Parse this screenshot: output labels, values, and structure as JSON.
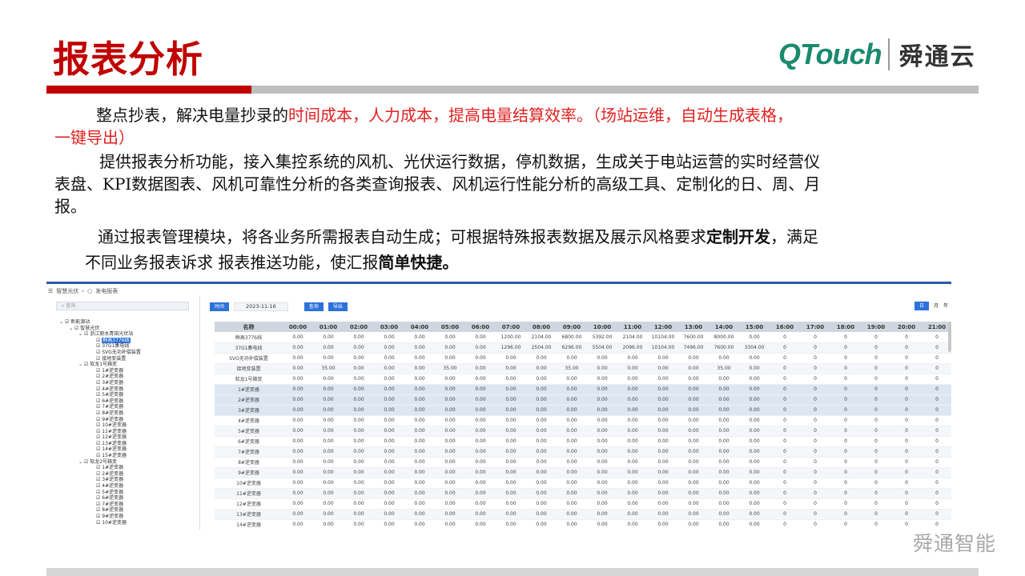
{
  "slide": {
    "title": "报表分析",
    "brand_latin": "QTouch",
    "brand_cn": "舜通云",
    "watermark": "舜通智能"
  },
  "text": {
    "p1_indent_a": "整点抄表，解决电量抄录的",
    "p1_red_a": "时间成本，人力成本，提高电量结算效率。（场站运维，自动生成表格，",
    "p1_red_b": "一键导出）",
    "p2_line1": "提供报表分析功能，接入集控系统的风机、光伏运行数据，停机数据，生成关于电站运营的实时经营仪",
    "p2_line2": "表盘、KPI数据图表、风机可靠性分析的各类查询报表、风机运行性能分析的高级工具、定制化的日、周、月",
    "p2_line3": "报。",
    "p3_line1_a": "通过报表管理模块，将各业务所需报表自动生成；可根据特殊报表数据及展示风格要求",
    "p3_line1_b": "定制开发",
    "p3_line1_c": "，满足",
    "p3_line2_a": "不同业务报表诉求 报表推送功能，使汇报",
    "p3_line2_b": "简单快捷。"
  },
  "app": {
    "breadcrumb": [
      "智慧光伏",
      "发电报表"
    ],
    "search_placeholder": "查询",
    "tree": [
      {
        "label": "新能源站",
        "level": 0,
        "arrow": true
      },
      {
        "label": "智慧光伏",
        "level": 1,
        "arrow": true
      },
      {
        "label": "浙江丽水青田光伏站",
        "level": 2,
        "arrow": true
      },
      {
        "label": "鲜高3776线",
        "level": 3,
        "selected": true
      },
      {
        "label": "37G1集电线",
        "level": 3
      },
      {
        "label": "SVG无功补偿装置",
        "level": 3
      },
      {
        "label": "接地变装置",
        "level": 3
      },
      {
        "label": "软龙1号箱变",
        "level": 2,
        "arrow": true
      },
      {
        "label": "1#逆变器",
        "level": 3
      },
      {
        "label": "2#逆变器",
        "level": 3
      },
      {
        "label": "3#逆变器",
        "level": 3
      },
      {
        "label": "4#逆变器",
        "level": 3
      },
      {
        "label": "5#逆变器",
        "level": 3
      },
      {
        "label": "6#逆变器",
        "level": 3
      },
      {
        "label": "7#逆变器",
        "level": 3
      },
      {
        "label": "8#逆变器",
        "level": 3
      },
      {
        "label": "9#逆变器",
        "level": 3
      },
      {
        "label": "10#逆变器",
        "level": 3
      },
      {
        "label": "11#逆变器",
        "level": 3
      },
      {
        "label": "12#逆变器",
        "level": 3
      },
      {
        "label": "13#逆变器",
        "level": 3
      },
      {
        "label": "14#逆变器",
        "level": 3
      },
      {
        "label": "15#逆变器",
        "level": 3
      },
      {
        "label": "软龙2号箱变",
        "level": 2,
        "arrow": true
      },
      {
        "label": "1#逆变器",
        "level": 3
      },
      {
        "label": "2#逆变器",
        "level": 3
      },
      {
        "label": "3#逆变器",
        "level": 3
      },
      {
        "label": "4#逆变器",
        "level": 3
      },
      {
        "label": "5#逆变器",
        "level": 3
      },
      {
        "label": "6#逆变器",
        "level": 3
      },
      {
        "label": "7#逆变器",
        "level": 3
      },
      {
        "label": "8#逆变器",
        "level": 3
      },
      {
        "label": "9#逆变器",
        "level": 3
      },
      {
        "label": "10#逆变器",
        "level": 3
      }
    ],
    "toolbar": {
      "time_label": "时间",
      "date_value": "2023-11-16",
      "query_label": "查询",
      "export_label": "导出",
      "period_day": "日",
      "period_month": "月",
      "period_year": "年"
    },
    "table": {
      "name_header": "名称",
      "hours": [
        "00:00",
        "01:00",
        "02:00",
        "03:00",
        "04:00",
        "05:00",
        "06:00",
        "07:00",
        "08:00",
        "09:00",
        "10:00",
        "11:00",
        "12:00",
        "13:00",
        "14:00",
        "15:00",
        "16:00",
        "17:00",
        "18:00",
        "19:00",
        "20:00",
        "21:00"
      ],
      "rows": [
        {
          "name": "鲜高3776线",
          "values": [
            "0.00",
            "0.00",
            "0.00",
            "0.00",
            "0.00",
            "0.00",
            "0.00",
            "1200.00",
            "2104.00",
            "6800.00",
            "5392.00",
            "2104.00",
            "10104.00",
            "7600.00",
            "8000.00",
            "0.00",
            "0",
            "0",
            "0",
            "0",
            "0",
            "0"
          ]
        },
        {
          "name": "37G1集电线",
          "values": [
            "0.00",
            "0.00",
            "0.00",
            "0.00",
            "0.00",
            "0.00",
            "0.00",
            "1296.00",
            "2504.00",
            "6296.00",
            "5504.00",
            "2096.00",
            "10104.00",
            "7496.00",
            "7600.00",
            "3304.00",
            "0",
            "0",
            "0",
            "0",
            "0",
            "0"
          ]
        },
        {
          "name": "SVG无功补偿装置",
          "values": [
            "0.00",
            "0.00",
            "0.00",
            "0.00",
            "0.00",
            "0.00",
            "0.00",
            "0.00",
            "0.00",
            "0.00",
            "0.00",
            "0.00",
            "0.00",
            "0.00",
            "0.00",
            "0.00",
            "0",
            "0",
            "0",
            "0",
            "0",
            "0"
          ]
        },
        {
          "name": "接地变装置",
          "values": [
            "0.00",
            "35.00",
            "0.00",
            "0.00",
            "0.00",
            "35.00",
            "0.00",
            "0.00",
            "0.00",
            "35.00",
            "0.00",
            "0.00",
            "0.00",
            "0.00",
            "35.00",
            "0.00",
            "0",
            "0",
            "0",
            "0",
            "0",
            "0"
          ]
        },
        {
          "name": "软龙1号箱变",
          "values": [
            "0.00",
            "0.00",
            "0.00",
            "0.00",
            "0.00",
            "0.00",
            "0.00",
            "0.00",
            "0.00",
            "0.00",
            "0.00",
            "0.00",
            "0.00",
            "0.00",
            "0.00",
            "0.00",
            "0",
            "0",
            "0",
            "0",
            "0",
            "0"
          ]
        },
        {
          "name": "1#逆变器",
          "values": [
            "0.00",
            "0.00",
            "0.00",
            "0.00",
            "0.00",
            "0.00",
            "0.00",
            "0.00",
            "0.00",
            "0.00",
            "0.00",
            "0.00",
            "0.00",
            "0.00",
            "0.00",
            "0.00",
            "0",
            "0",
            "0",
            "0",
            "0",
            "0"
          ]
        },
        {
          "name": "2#逆变器",
          "values": [
            "0.00",
            "0.00",
            "0.00",
            "0.00",
            "0.00",
            "0.00",
            "0.00",
            "0.00",
            "0.00",
            "0.00",
            "0.00",
            "0.00",
            "0.00",
            "0.00",
            "0.00",
            "0.00",
            "0",
            "0",
            "0",
            "0",
            "0",
            "0"
          ]
        },
        {
          "name": "3#逆变器",
          "values": [
            "0.00",
            "0.00",
            "0.00",
            "0.00",
            "0.00",
            "0.00",
            "0.00",
            "0.00",
            "0.00",
            "0.00",
            "0.00",
            "0.00",
            "0.00",
            "0.00",
            "0.00",
            "0.00",
            "0",
            "0",
            "0",
            "0",
            "0",
            "0"
          ]
        },
        {
          "name": "4#逆变器",
          "values": [
            "0.00",
            "0.00",
            "0.00",
            "0.00",
            "0.00",
            "0.00",
            "0.00",
            "0.00",
            "0.00",
            "0.00",
            "0.00",
            "0.00",
            "0.00",
            "0.00",
            "0.00",
            "0.00",
            "0",
            "0",
            "0",
            "0",
            "0",
            "0"
          ]
        },
        {
          "name": "5#逆变器",
          "values": [
            "0.00",
            "0.00",
            "0.00",
            "0.00",
            "0.00",
            "0.00",
            "0.00",
            "0.00",
            "0.00",
            "0.00",
            "0.00",
            "0.00",
            "0.00",
            "0.00",
            "0.00",
            "0.00",
            "0",
            "0",
            "0",
            "0",
            "0",
            "0"
          ]
        },
        {
          "name": "6#逆变器",
          "values": [
            "0.00",
            "0.00",
            "0.00",
            "0.00",
            "0.00",
            "0.00",
            "0.00",
            "0.00",
            "0.00",
            "0.00",
            "0.00",
            "0.00",
            "0.00",
            "0.00",
            "0.00",
            "0.00",
            "0",
            "0",
            "0",
            "0",
            "0",
            "0"
          ]
        },
        {
          "name": "7#逆变器",
          "values": [
            "0.00",
            "0.00",
            "0.00",
            "0.00",
            "0.00",
            "0.00",
            "0.00",
            "0.00",
            "0.00",
            "0.00",
            "0.00",
            "0.00",
            "0.00",
            "0.00",
            "0.00",
            "0.00",
            "0",
            "0",
            "0",
            "0",
            "0",
            "0"
          ]
        },
        {
          "name": "8#逆变器",
          "values": [
            "0.00",
            "0.00",
            "0.00",
            "0.00",
            "0.00",
            "0.00",
            "0.00",
            "0.00",
            "0.00",
            "0.00",
            "0.00",
            "0.00",
            "0.00",
            "0.00",
            "0.00",
            "0.00",
            "0",
            "0",
            "0",
            "0",
            "0",
            "0"
          ]
        },
        {
          "name": "9#逆变器",
          "values": [
            "0.00",
            "0.00",
            "0.00",
            "0.00",
            "0.00",
            "0.00",
            "0.00",
            "0.00",
            "0.00",
            "0.00",
            "0.00",
            "0.00",
            "0.00",
            "0.00",
            "0.00",
            "0.00",
            "0",
            "0",
            "0",
            "0",
            "0",
            "0"
          ]
        },
        {
          "name": "10#逆变器",
          "values": [
            "0.00",
            "0.00",
            "0.00",
            "0.00",
            "0.00",
            "0.00",
            "0.00",
            "0.00",
            "0.00",
            "0.00",
            "0.00",
            "0.00",
            "0.00",
            "0.00",
            "0.00",
            "0.00",
            "0",
            "0",
            "0",
            "0",
            "0",
            "0"
          ]
        },
        {
          "name": "11#逆变器",
          "values": [
            "0.00",
            "0.00",
            "0.00",
            "0.00",
            "0.00",
            "0.00",
            "0.00",
            "0.00",
            "0.00",
            "0.00",
            "0.00",
            "0.00",
            "0.00",
            "0.00",
            "0.00",
            "0.00",
            "0",
            "0",
            "0",
            "0",
            "0",
            "0"
          ]
        },
        {
          "name": "12#逆变器",
          "values": [
            "0.00",
            "0.00",
            "0.00",
            "0.00",
            "0.00",
            "0.00",
            "0.00",
            "0.00",
            "0.00",
            "0.00",
            "0.00",
            "0.00",
            "0.00",
            "0.00",
            "0.00",
            "0.00",
            "0",
            "0",
            "0",
            "0",
            "0",
            "0"
          ]
        },
        {
          "name": "13#逆变器",
          "values": [
            "0.00",
            "0.00",
            "0.00",
            "0.00",
            "0.00",
            "0.00",
            "0.00",
            "0.00",
            "0.00",
            "0.00",
            "0.00",
            "0.00",
            "0.00",
            "0.00",
            "0.00",
            "0.00",
            "0",
            "0",
            "0",
            "0",
            "0",
            "0"
          ]
        },
        {
          "name": "14#逆变器",
          "values": [
            "0.00",
            "0.00",
            "0.00",
            "0.00",
            "0.00",
            "0.00",
            "0.00",
            "0.00",
            "0.00",
            "0.00",
            "0.00",
            "0.00",
            "0.00",
            "0.00",
            "0.00",
            "0.00",
            "0",
            "0",
            "0",
            "0",
            "0",
            "0"
          ]
        }
      ]
    }
  },
  "colors": {
    "title_red": "#c00000",
    "highlight_red": "#e02020",
    "brand_green": "#1a8a6e",
    "app_blue": "#2d72d9",
    "header_gray": "#cfd6df"
  }
}
